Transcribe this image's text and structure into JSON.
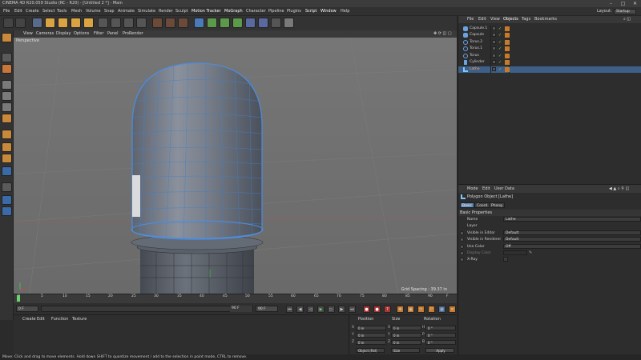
{
  "window": {
    "title": "CINEMA 4D R20.059 Studio (RC - R20) - [Untitled 2 *] - Main"
  },
  "menu": [
    "File",
    "Edit",
    "Create",
    "Select",
    "Tools",
    "Mesh",
    "Volume",
    "Snap",
    "Animate",
    "Simulate",
    "Render",
    "Sculpt",
    "Motion Tracker",
    "MoGraph",
    "Character",
    "Pipeline",
    "Plugins",
    "Script",
    "Window",
    "Help"
  ],
  "layout": {
    "label": "Layout:",
    "value": "Startup"
  },
  "viewport": {
    "menu": [
      "View",
      "Cameras",
      "Display",
      "Options",
      "Filter",
      "Panel",
      "ProRender"
    ],
    "label": "Perspective",
    "grid_spacing": "Grid Spacing : 39.37 in"
  },
  "timeline": {
    "ticks": [
      "0",
      "5",
      "10",
      "15",
      "20",
      "25",
      "30",
      "35",
      "40",
      "45",
      "50",
      "55",
      "60",
      "65",
      "70",
      "75",
      "80",
      "85",
      "90"
    ],
    "suffix": "F"
  },
  "anim": {
    "start": "0 F",
    "current": "0 F",
    "end_inner": "90 F",
    "end": "90 F"
  },
  "material": {
    "menu": [
      "Create",
      "Edit",
      "Function",
      "Texture"
    ]
  },
  "coords": {
    "headers": [
      "Position",
      "Size",
      "Rotation"
    ],
    "axes": [
      "X",
      "Y",
      "Z"
    ],
    "size_axes": [
      "X",
      "Y",
      "Z"
    ],
    "rot_axes": [
      "H",
      "P",
      "B"
    ],
    "position": [
      "0 in",
      "0 in",
      "0 in"
    ],
    "size": [
      "0 in",
      "0 in",
      "0 in"
    ],
    "rotation": [
      "0 °",
      "0 °",
      "0 °"
    ],
    "mode": "Object (Rel)",
    "size_mode": "Size",
    "apply": "Apply"
  },
  "status": "Move: Click and drag to move elements. Hold down SHIFT to quantize movement / add to the selection in point mode, CTRL to remove.",
  "objects": {
    "menu": [
      "File",
      "Edit",
      "View",
      "Objects",
      "Tags",
      "Bookmarks"
    ],
    "items": [
      {
        "name": "Capsule.1",
        "color": "#6aa3e0"
      },
      {
        "name": "Capsule",
        "color": "#6aa3e0"
      },
      {
        "name": "Torus.2",
        "color": "#6aa3e0"
      },
      {
        "name": "Torus.1",
        "color": "#6aa3e0"
      },
      {
        "name": "Torus",
        "color": "#6aa3e0"
      },
      {
        "name": "Cylinder",
        "color": "#6aa3e0"
      },
      {
        "name": "Lathe",
        "color": "#7fc8ff"
      }
    ]
  },
  "attributes": {
    "menu": [
      "Mode",
      "Edit",
      "User Data"
    ],
    "header": "Polygon Object [Lathe]",
    "tabs": [
      "Basic",
      "Coord.",
      "Phong"
    ],
    "section": "Basic Properties",
    "props": [
      {
        "label": "Name",
        "value": "Lathe"
      },
      {
        "label": "Layer",
        "value": ""
      },
      {
        "label": "Visible in Editor",
        "value": "Default"
      },
      {
        "label": "Visible in Renderer",
        "value": "Default"
      },
      {
        "label": "Use Color",
        "value": "Off"
      },
      {
        "label": "Display Color",
        "value": ""
      },
      {
        "label": "X-Ray",
        "value": ""
      }
    ]
  },
  "colors": {
    "accent": "#5b83b2",
    "selection": "#3d5f88",
    "viewport": "#707070"
  }
}
